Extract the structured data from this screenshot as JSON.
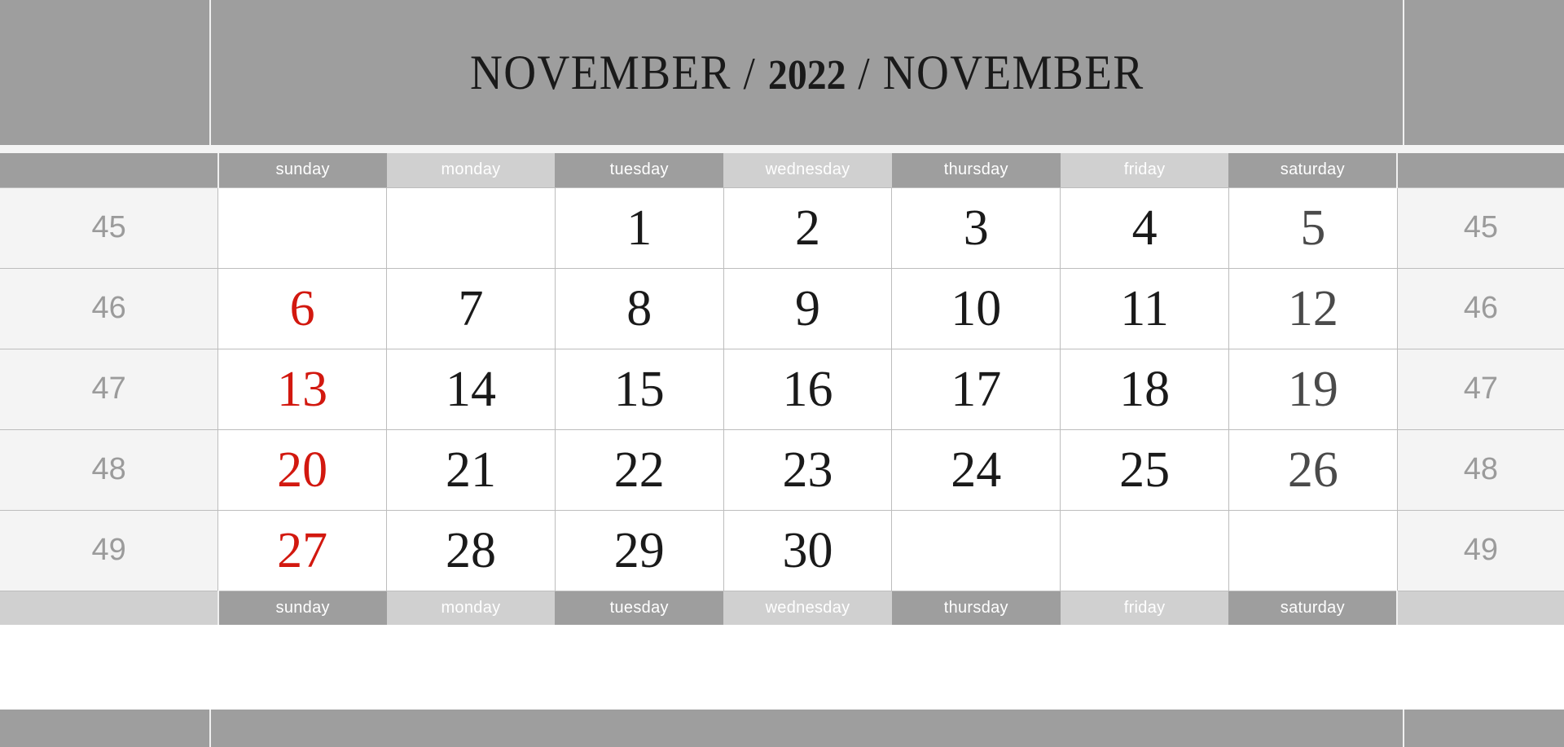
{
  "title": {
    "month_left": "NOVEMBER",
    "separator": "/",
    "year": "2022",
    "month_right": "NOVEMBER"
  },
  "weekdays": [
    "sunday",
    "monday",
    "tuesday",
    "wednesday",
    "thursday",
    "friday",
    "saturday"
  ],
  "week_numbers": [
    "45",
    "46",
    "47",
    "48",
    "49"
  ],
  "colors": {
    "band": "#9e9e9e",
    "weekday_dark": "#9e9e9e",
    "weekday_light": "#d0d0d0",
    "weeknum_bg": "#f4f4f4",
    "weeknum_text": "#9b9b9b",
    "day_text": "#1a1a1a",
    "sunday_text": "#d2180f",
    "saturday_text": "#4a4a4a",
    "grid_line": "#bdbdbd",
    "cell_bg": "#ffffff"
  },
  "weeks": [
    {
      "number": "45",
      "days": [
        "",
        "",
        "1",
        "2",
        "3",
        "4",
        "5"
      ]
    },
    {
      "number": "46",
      "days": [
        "6",
        "7",
        "8",
        "9",
        "10",
        "11",
        "12"
      ]
    },
    {
      "number": "47",
      "days": [
        "13",
        "14",
        "15",
        "16",
        "17",
        "18",
        "19"
      ]
    },
    {
      "number": "48",
      "days": [
        "20",
        "21",
        "22",
        "23",
        "24",
        "25",
        "26"
      ]
    },
    {
      "number": "49",
      "days": [
        "27",
        "28",
        "29",
        "30",
        "",
        "",
        ""
      ]
    }
  ]
}
